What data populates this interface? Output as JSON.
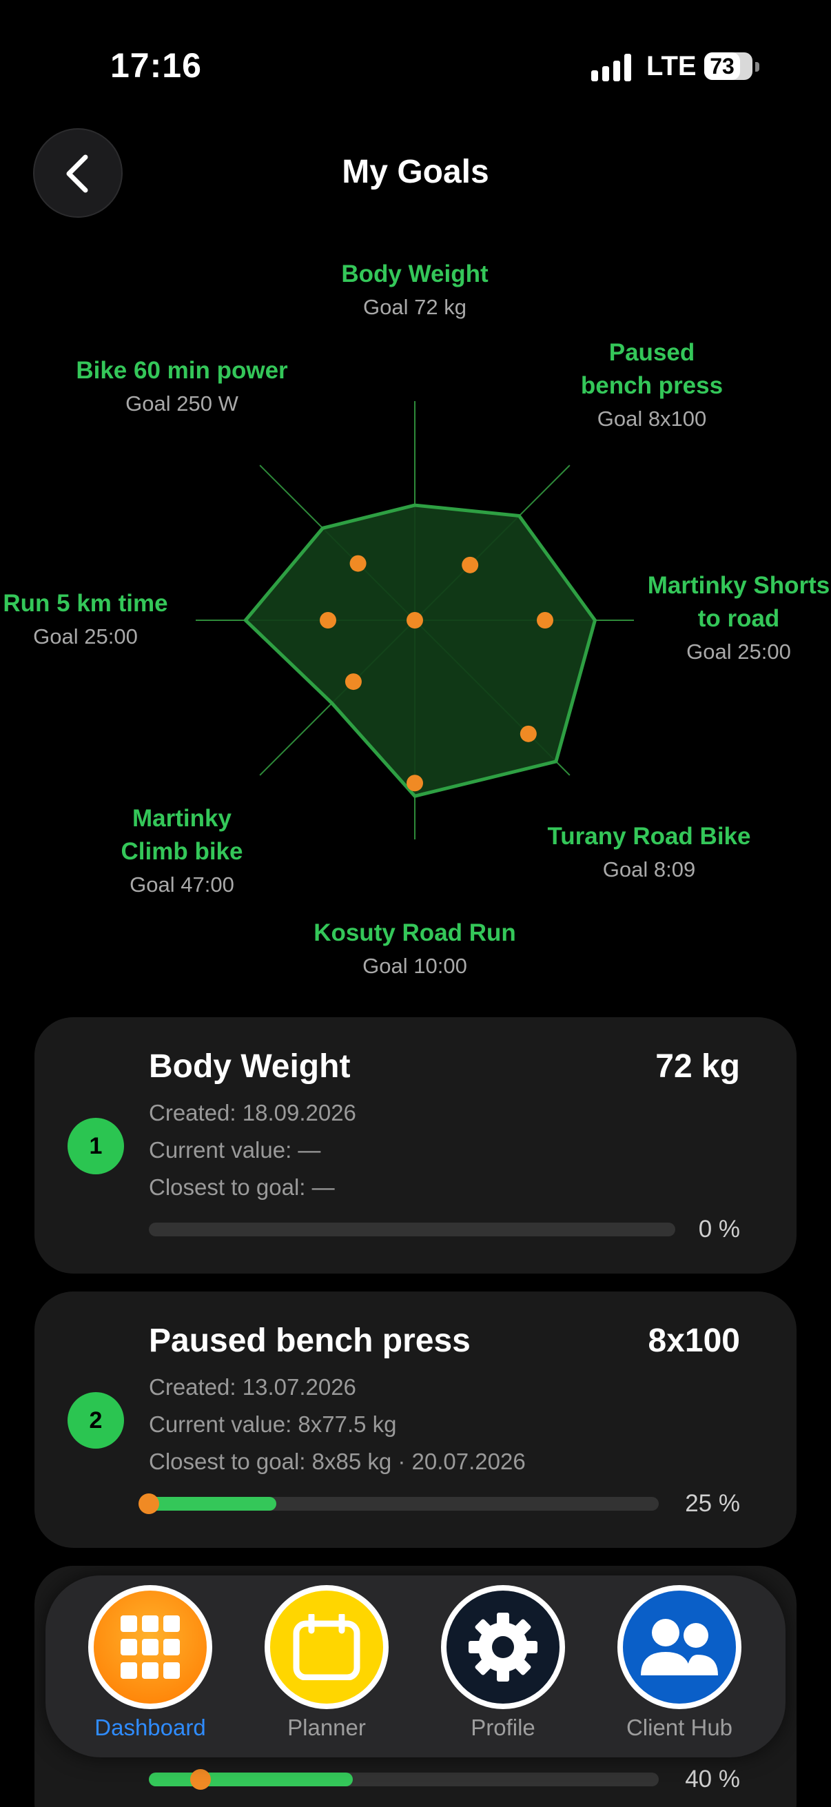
{
  "status_bar": {
    "time": "17:16",
    "network": "LTE",
    "battery": "73"
  },
  "header": {
    "title": "My Goals",
    "back_icon": "chevron-left-icon"
  },
  "radar": {
    "colors": {
      "axis": "#2e8b3a",
      "fill": "#113d18",
      "outline": "#2ea043",
      "marker": "#f08a24",
      "label": "#34c759"
    },
    "axes": [
      {
        "name": "Body Weight",
        "goal": "Goal 72 kg",
        "outline_level": 0.53,
        "marker_level": 0.0
      },
      {
        "name": "Paused\nbench press",
        "goal": "Goal 8x100",
        "outline_level": 0.68,
        "marker_level": 0.36
      },
      {
        "name": "Martinky Shorts\nto road",
        "goal": "Goal 25:00",
        "outline_level": 0.83,
        "marker_level": 0.6
      },
      {
        "name": "Turany Road Bike",
        "goal": "Goal 8:09",
        "outline_level": 0.92,
        "marker_level": 0.74
      },
      {
        "name": "Kosuty Road Run",
        "goal": "Goal 10:00",
        "outline_level": 0.81,
        "marker_level": 0.75
      },
      {
        "name": "Martinky\nClimb bike",
        "goal": "Goal 47:00",
        "outline_level": 0.54,
        "marker_level": 0.4
      },
      {
        "name": "Run 5 km time",
        "goal": "Goal 25:00",
        "outline_level": 0.78,
        "marker_level": 0.4
      },
      {
        "name": "Bike 60 min power",
        "goal": "Goal 250 W",
        "outline_level": 0.6,
        "marker_level": 0.37
      }
    ]
  },
  "goals": [
    {
      "number": "1",
      "title": "Body Weight",
      "target": "72 kg",
      "created": "Created: 18.09.2026",
      "current": "Current value: —",
      "closest": "Closest to goal: —",
      "percent_label": "0 %",
      "progress": 0
    },
    {
      "number": "2",
      "title": "Paused bench press",
      "target": "8x100",
      "created": "Created: 13.07.2026",
      "current": "Current value: 8x77.5 kg",
      "closest": "Closest to goal: 8x85 kg · 20.07.2026",
      "percent_label": "25 %",
      "progress": 0.25
    },
    {
      "percent_label": "40 %",
      "progress": 0.4
    }
  ],
  "tabs": [
    {
      "label": "Dashboard",
      "icon": "grid-icon",
      "active": true
    },
    {
      "label": "Planner",
      "icon": "calendar-icon",
      "active": false
    },
    {
      "label": "Profile",
      "icon": "gear-icon",
      "active": false
    },
    {
      "label": "Client Hub",
      "icon": "users-icon",
      "active": false
    }
  ]
}
